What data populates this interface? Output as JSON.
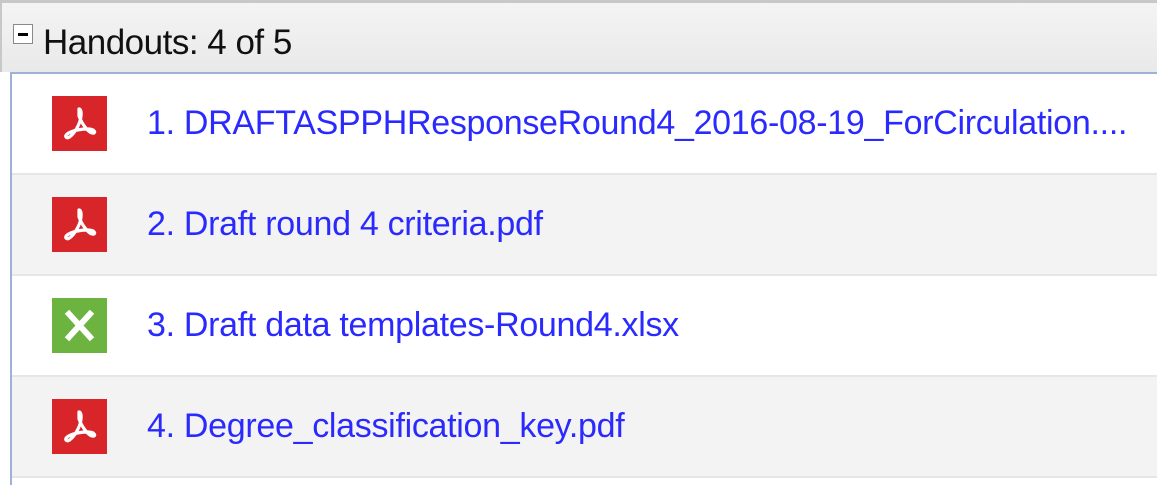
{
  "handouts": {
    "title": "Handouts: 4 of 5",
    "items": [
      {
        "label": "1. DRAFTASPPHResponseRound4_2016-08-19_ForCirculation....",
        "type": "pdf"
      },
      {
        "label": "2. Draft round 4 criteria.pdf",
        "type": "pdf"
      },
      {
        "label": "3. Draft data templates-Round4.xlsx",
        "type": "xlsx"
      },
      {
        "label": "4. Degree_classification_key.pdf",
        "type": "pdf"
      }
    ]
  },
  "colors": {
    "pdf": "#d8252a",
    "xlsx": "#6db33f",
    "link": "#2a2aff",
    "list_border": "#9fb2d6"
  },
  "icons": {
    "toggle": "collapse-minus-icon",
    "pdf": "pdf-file-icon",
    "xlsx": "excel-file-icon"
  }
}
